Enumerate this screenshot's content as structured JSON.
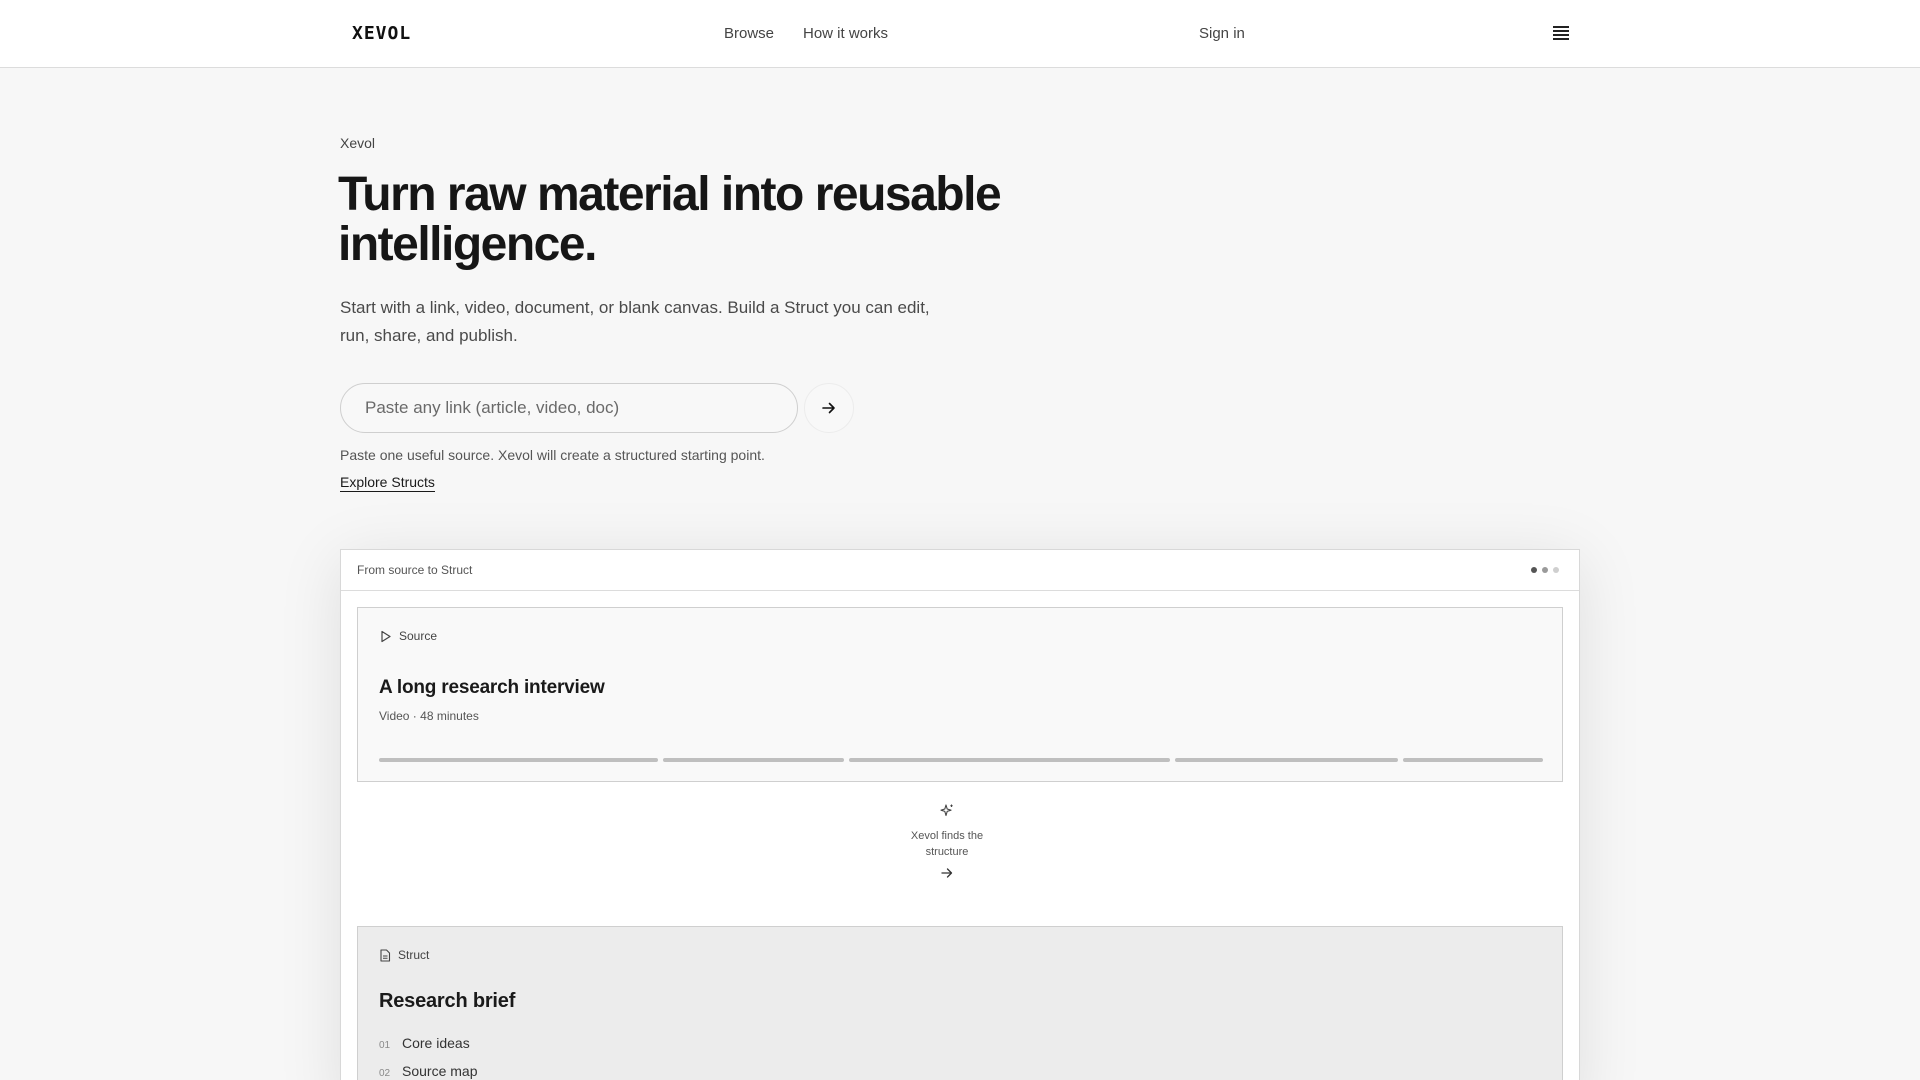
{
  "header": {
    "logo": "XEVOL",
    "nav": {
      "browse": "Browse",
      "how_it_works": "How it works",
      "sign_in": "Sign in"
    }
  },
  "hero": {
    "eyebrow": "Xevol",
    "headline": "Turn raw material into reusable intelligence.",
    "subhead": "Start with a link, video, document, or blank canvas. Build a Struct you can edit, run, share, and publish.",
    "input_placeholder": "Paste any link (article, video, doc)",
    "helper": "Paste one useful source. Xevol will create a structured starting point.",
    "explore_link": "Explore Structs"
  },
  "demo": {
    "title": "From source to Struct",
    "dot_colors": [
      "#555555",
      "#9a9a9a",
      "#cfcfcf"
    ],
    "source": {
      "label": "Source",
      "icon": "play-icon",
      "heading": "A long research interview",
      "meta": "Video · 48 minutes",
      "segment_fractions": [
        0.2,
        0.13,
        0.23,
        0.16,
        0.1
      ]
    },
    "transition": {
      "icon": "sparkle-icon",
      "text": "Xevol finds the structure",
      "arrow_icon": "arrow-right-icon"
    },
    "struct": {
      "label": "Struct",
      "icon": "document-icon",
      "heading": "Research brief",
      "outline": [
        {
          "num": "01",
          "label": "Core ideas"
        },
        {
          "num": "02",
          "label": "Source map"
        }
      ]
    }
  }
}
